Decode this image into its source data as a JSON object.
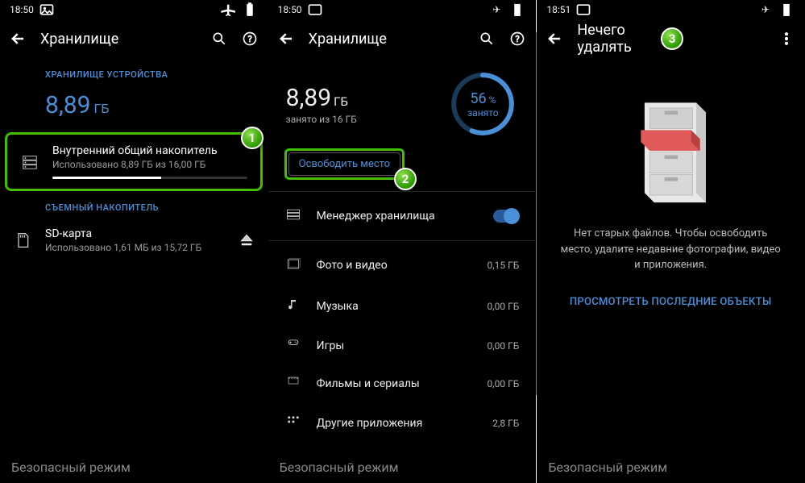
{
  "status": {
    "time1": "18:50",
    "time2": "18:50",
    "time3": "18:51"
  },
  "p1": {
    "title": "Хранилище",
    "device_label": "ХРАНИЛИЩЕ УСТРОЙСТВА",
    "used_value": "8,89",
    "used_unit": "ГБ",
    "internal": {
      "title": "Внутренний общий накопитель",
      "sub": "Использовано 8,89 ГБ из 16,00 ГБ",
      "pct": 56
    },
    "removable_label": "СЪЕМНЫЙ НАКОПИТЕЛЬ",
    "sd": {
      "title": "SD-карта",
      "sub": "Использовано 1,61 МБ из 15,72 ГБ"
    },
    "safe_mode": "Безопасный режим"
  },
  "p2": {
    "title": "Хранилище",
    "used_value": "8,89",
    "used_unit": "ГБ",
    "sub": "занято из 16 ГБ",
    "pct_text": "56",
    "pct_sym": "%",
    "pct_label": "занято",
    "free_btn": "Освободить место",
    "cats": [
      {
        "label": "Менеджер хранилища",
        "toggle": true
      },
      {
        "label": "Фото и видео",
        "value": "0,15 ГБ"
      },
      {
        "label": "Музыка",
        "value": "0,00 ГБ"
      },
      {
        "label": "Игры",
        "value": "0,00 ГБ"
      },
      {
        "label": "Фильмы и сериалы",
        "value": "0,00 ГБ"
      },
      {
        "label": "Другие приложения",
        "value": "2,8 ГБ"
      }
    ],
    "safe_mode": "Безопасный режим"
  },
  "p3": {
    "title": "Нечего удалять",
    "empty": "Нет старых файлов. Чтобы освободить место, удалите недавние фотографии, видео и приложения.",
    "link": "ПРОСМОТРЕТЬ ПОСЛЕДНИЕ ОБЪЕКТЫ",
    "safe_mode": "Безопасный режим"
  },
  "badges": {
    "b1": "1",
    "b2": "2",
    "b3": "3"
  }
}
